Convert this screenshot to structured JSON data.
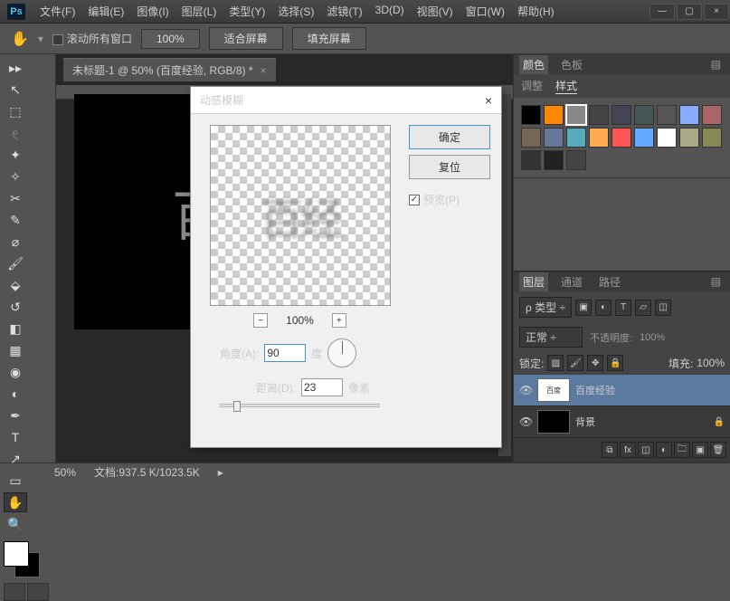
{
  "app": {
    "logo": "Ps"
  },
  "menu": {
    "file": "文件(F)",
    "edit": "编辑(E)",
    "image": "图像(I)",
    "layer": "图层(L)",
    "type": "类型(Y)",
    "select": "选择(S)",
    "filter": "滤镜(T)",
    "threeD": "3D(D)",
    "view": "视图(V)",
    "window": "窗口(W)",
    "help": "帮助(H)"
  },
  "win": {
    "min": "—",
    "max": "▢",
    "close": "×"
  },
  "options": {
    "scroll_all": "滚动所有窗口",
    "zoom_100": "100%",
    "fit_screen": "适合屏幕",
    "fill_screen": "填充屏幕"
  },
  "doc": {
    "tab_title": "未标题-1 @ 50% (百度经验, RGB/8) *",
    "canvas_text": "百"
  },
  "status": {
    "zoom": "50%",
    "doc_size_label": "文档:",
    "doc_size": "937.5 K/1023.5K"
  },
  "panels": {
    "color_tab": "颜色",
    "swatch_tab": "色板",
    "adjust_tab": "调整",
    "style_tab": "样式",
    "layers_tab": "图层",
    "channels_tab": "通道",
    "paths_tab": "路径",
    "kind_label": "ρ 类型",
    "blend_mode": "正常",
    "opacity_label": "不透明度:",
    "opacity_val": "100%",
    "lock_label": "锁定:",
    "fill_label": "填充:",
    "fill_val": "100%",
    "layer1_name": "百度经验",
    "layer2_name": "背景"
  },
  "swatch_colors": [
    "#000",
    "#f80",
    "#888",
    "#444",
    "#445",
    "#455",
    "#555",
    "#8af",
    "#a66",
    "#765",
    "#679",
    "#5ab",
    "#fa5",
    "#f55",
    "#6af",
    "#fff",
    "#aa8",
    "#885",
    "#333",
    "#222",
    "#444"
  ],
  "dialog": {
    "title": "动感模糊",
    "ok": "确定",
    "reset": "复位",
    "preview": "预览(P)",
    "zoom_value": "100%",
    "angle_label": "角度(A):",
    "angle_value": "90",
    "angle_unit": "度",
    "distance_label": "距离(D):",
    "distance_value": "23",
    "distance_unit": "像素",
    "preview_text": "百经"
  }
}
